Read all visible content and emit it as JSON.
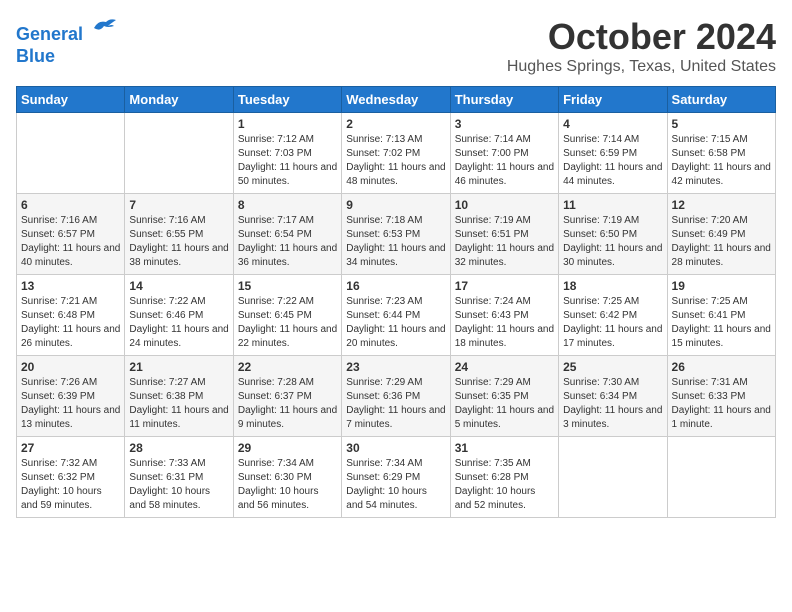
{
  "header": {
    "logo_line1": "General",
    "logo_line2": "Blue",
    "month": "October 2024",
    "location": "Hughes Springs, Texas, United States"
  },
  "weekdays": [
    "Sunday",
    "Monday",
    "Tuesday",
    "Wednesday",
    "Thursday",
    "Friday",
    "Saturday"
  ],
  "weeks": [
    [
      {
        "num": "",
        "info": ""
      },
      {
        "num": "",
        "info": ""
      },
      {
        "num": "1",
        "info": "Sunrise: 7:12 AM\nSunset: 7:03 PM\nDaylight: 11 hours and 50 minutes."
      },
      {
        "num": "2",
        "info": "Sunrise: 7:13 AM\nSunset: 7:02 PM\nDaylight: 11 hours and 48 minutes."
      },
      {
        "num": "3",
        "info": "Sunrise: 7:14 AM\nSunset: 7:00 PM\nDaylight: 11 hours and 46 minutes."
      },
      {
        "num": "4",
        "info": "Sunrise: 7:14 AM\nSunset: 6:59 PM\nDaylight: 11 hours and 44 minutes."
      },
      {
        "num": "5",
        "info": "Sunrise: 7:15 AM\nSunset: 6:58 PM\nDaylight: 11 hours and 42 minutes."
      }
    ],
    [
      {
        "num": "6",
        "info": "Sunrise: 7:16 AM\nSunset: 6:57 PM\nDaylight: 11 hours and 40 minutes."
      },
      {
        "num": "7",
        "info": "Sunrise: 7:16 AM\nSunset: 6:55 PM\nDaylight: 11 hours and 38 minutes."
      },
      {
        "num": "8",
        "info": "Sunrise: 7:17 AM\nSunset: 6:54 PM\nDaylight: 11 hours and 36 minutes."
      },
      {
        "num": "9",
        "info": "Sunrise: 7:18 AM\nSunset: 6:53 PM\nDaylight: 11 hours and 34 minutes."
      },
      {
        "num": "10",
        "info": "Sunrise: 7:19 AM\nSunset: 6:51 PM\nDaylight: 11 hours and 32 minutes."
      },
      {
        "num": "11",
        "info": "Sunrise: 7:19 AM\nSunset: 6:50 PM\nDaylight: 11 hours and 30 minutes."
      },
      {
        "num": "12",
        "info": "Sunrise: 7:20 AM\nSunset: 6:49 PM\nDaylight: 11 hours and 28 minutes."
      }
    ],
    [
      {
        "num": "13",
        "info": "Sunrise: 7:21 AM\nSunset: 6:48 PM\nDaylight: 11 hours and 26 minutes."
      },
      {
        "num": "14",
        "info": "Sunrise: 7:22 AM\nSunset: 6:46 PM\nDaylight: 11 hours and 24 minutes."
      },
      {
        "num": "15",
        "info": "Sunrise: 7:22 AM\nSunset: 6:45 PM\nDaylight: 11 hours and 22 minutes."
      },
      {
        "num": "16",
        "info": "Sunrise: 7:23 AM\nSunset: 6:44 PM\nDaylight: 11 hours and 20 minutes."
      },
      {
        "num": "17",
        "info": "Sunrise: 7:24 AM\nSunset: 6:43 PM\nDaylight: 11 hours and 18 minutes."
      },
      {
        "num": "18",
        "info": "Sunrise: 7:25 AM\nSunset: 6:42 PM\nDaylight: 11 hours and 17 minutes."
      },
      {
        "num": "19",
        "info": "Sunrise: 7:25 AM\nSunset: 6:41 PM\nDaylight: 11 hours and 15 minutes."
      }
    ],
    [
      {
        "num": "20",
        "info": "Sunrise: 7:26 AM\nSunset: 6:39 PM\nDaylight: 11 hours and 13 minutes."
      },
      {
        "num": "21",
        "info": "Sunrise: 7:27 AM\nSunset: 6:38 PM\nDaylight: 11 hours and 11 minutes."
      },
      {
        "num": "22",
        "info": "Sunrise: 7:28 AM\nSunset: 6:37 PM\nDaylight: 11 hours and 9 minutes."
      },
      {
        "num": "23",
        "info": "Sunrise: 7:29 AM\nSunset: 6:36 PM\nDaylight: 11 hours and 7 minutes."
      },
      {
        "num": "24",
        "info": "Sunrise: 7:29 AM\nSunset: 6:35 PM\nDaylight: 11 hours and 5 minutes."
      },
      {
        "num": "25",
        "info": "Sunrise: 7:30 AM\nSunset: 6:34 PM\nDaylight: 11 hours and 3 minutes."
      },
      {
        "num": "26",
        "info": "Sunrise: 7:31 AM\nSunset: 6:33 PM\nDaylight: 11 hours and 1 minute."
      }
    ],
    [
      {
        "num": "27",
        "info": "Sunrise: 7:32 AM\nSunset: 6:32 PM\nDaylight: 10 hours and 59 minutes."
      },
      {
        "num": "28",
        "info": "Sunrise: 7:33 AM\nSunset: 6:31 PM\nDaylight: 10 hours and 58 minutes."
      },
      {
        "num": "29",
        "info": "Sunrise: 7:34 AM\nSunset: 6:30 PM\nDaylight: 10 hours and 56 minutes."
      },
      {
        "num": "30",
        "info": "Sunrise: 7:34 AM\nSunset: 6:29 PM\nDaylight: 10 hours and 54 minutes."
      },
      {
        "num": "31",
        "info": "Sunrise: 7:35 AM\nSunset: 6:28 PM\nDaylight: 10 hours and 52 minutes."
      },
      {
        "num": "",
        "info": ""
      },
      {
        "num": "",
        "info": ""
      }
    ]
  ]
}
